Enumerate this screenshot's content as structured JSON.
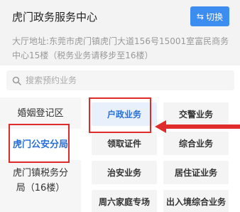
{
  "header": {
    "center_name": "虎门政务服务中心",
    "switch_label": "切换",
    "address": "大厅地址:东莞市虎门镇虎门大道156号15001室富民商务中心15楼（税务业务请移步至16楼）"
  },
  "search": {
    "placeholder": "搜索预约业务"
  },
  "sidebar": {
    "items": [
      {
        "label": "婚姻登记区",
        "active": false
      },
      {
        "label": "虎门公安分局",
        "active": true
      },
      {
        "label": "虎门镇税务分局（16楼）",
        "active": false
      }
    ]
  },
  "services": {
    "items": [
      {
        "label": "户政业务",
        "active": true
      },
      {
        "label": "交警业务",
        "active": false
      },
      {
        "label": "领取证件",
        "active": false
      },
      {
        "label": "综合业务",
        "active": false
      },
      {
        "label": "治安业务",
        "active": false
      },
      {
        "label": "居住证业务",
        "active": false
      },
      {
        "label": "周六家庭专场",
        "active": false
      },
      {
        "label": "出入境综合业务",
        "active": false
      }
    ]
  },
  "colors": {
    "accent": "#3d8cf0",
    "active_text": "#2a6fd6",
    "annotation_red": "#e02b2b"
  },
  "icons": {
    "switch": "swap-arrows-icon",
    "search": "search-icon",
    "annotation": "red-arrow-icon"
  }
}
